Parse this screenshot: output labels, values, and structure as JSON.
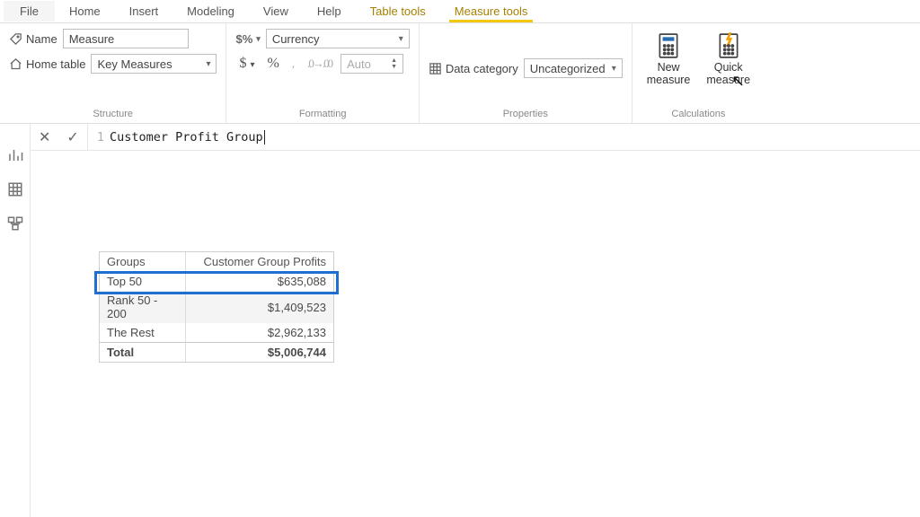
{
  "menu": {
    "file": "File",
    "home": "Home",
    "insert": "Insert",
    "modeling": "Modeling",
    "view": "View",
    "help": "Help",
    "table_tools": "Table tools",
    "measure_tools": "Measure tools"
  },
  "ribbon": {
    "structure": {
      "label": "Structure",
      "name_lbl": "Name",
      "name_val": "Measure",
      "home_table_lbl": "Home table",
      "home_table_val": "Key Measures"
    },
    "formatting": {
      "label": "Formatting",
      "format_val": "Currency",
      "dollar": "$",
      "percent": "%",
      "comma": ",",
      "decimals": "Auto",
      "badge": "$%"
    },
    "properties": {
      "label": "Properties",
      "data_category_lbl": "Data category",
      "data_category_val": "Uncategorized"
    },
    "calculations": {
      "label": "Calculations",
      "new_measure_l1": "New",
      "new_measure_l2": "measure",
      "quick_measure_l1": "Quick",
      "quick_measure_l2": "measure"
    }
  },
  "formula": {
    "line": "1",
    "text": "Customer Profit Group"
  },
  "table": {
    "col0": "Groups",
    "col1": "Customer Group Profits",
    "rows": [
      {
        "g": "Top 50",
        "v": "$635,088"
      },
      {
        "g": "Rank 50 - 200",
        "v": "$1,409,523"
      },
      {
        "g": "The Rest",
        "v": "$2,962,133"
      }
    ],
    "total_lbl": "Total",
    "total_val": "$5,006,744"
  },
  "colors": {
    "accent": "#f2c811",
    "highlight": "#1f6fd0"
  }
}
